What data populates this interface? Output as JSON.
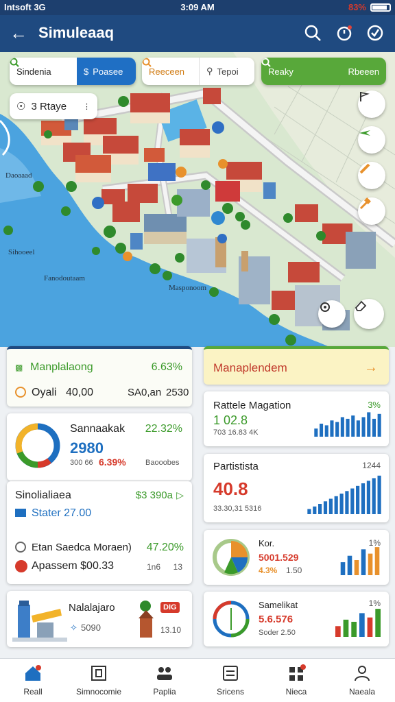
{
  "status": {
    "left": "Intsoft  3G",
    "time": "3:09 AM",
    "battery": "83%"
  },
  "appbar": {
    "title": "Simuleaaq",
    "icons": [
      "back-arrow-icon",
      "search-icon",
      "notification-icon",
      "clock-check-icon"
    ]
  },
  "map": {
    "chips": {
      "a1": "Sindenia",
      "a2": "Poasee",
      "b1": "Reeceen",
      "b2": "Tepoi",
      "c1": "Reaky",
      "c2": "Rbeeen"
    },
    "layer_chip": "3  Rtaye",
    "labels": [
      "Daoaaad",
      "Sihooeel",
      "Fanodoutaam",
      "Masponoom"
    ],
    "side_buttons": [
      "flag-icon",
      "plane-icon",
      "pencil-icon",
      "hammer-icon"
    ],
    "bottom_buttons": [
      "recenter-icon",
      "eraser-icon"
    ]
  },
  "colors": {
    "primary": "#1f4a80",
    "green": "#3b9a2a",
    "red": "#d63a2b",
    "blue": "#1e6fc0",
    "orange": "#e8912c"
  },
  "cards": {
    "top_left": {
      "title": "Manplalaong",
      "pct": "6.63%",
      "sub_label": "Oyali",
      "v1": "40,00",
      "v2": "SA0,an",
      "v3": "2530"
    },
    "top_right": {
      "title": "Manaplendem",
      "arrow": "→"
    },
    "mid_left": {
      "title": "Sannaakak",
      "pct": "22.32%",
      "value": "2980",
      "sub1": "300 66",
      "sub2": "6.39%",
      "sub3": "Baooobes"
    },
    "stats_left": {
      "row1_label": "Sinolialiaea",
      "row1_value": "$3 390a",
      "row2_label": "Stater 27.00",
      "row3_label": "Etan Saedca Moraen)",
      "row3_value": "47.20%",
      "row4_label": "Apassem $00.33",
      "row4_value": "1n6",
      "row4_extra": "13"
    },
    "bottom_left": {
      "title": "Nalalajaro",
      "badge": "DIG",
      "sub": "5090",
      "extra": "13.10"
    },
    "r1": {
      "title": "Rattele Magation",
      "pct": "3%",
      "value": "1 02.8",
      "sub": "703 16.83 4K"
    },
    "r2": {
      "title": "Partistista",
      "pct": "1244",
      "value": "40.8",
      "sub": "33.30,31 5316"
    },
    "r3": {
      "title": "Kor.",
      "pct": "1%",
      "value": "5001.529",
      "sub": "4.3%",
      "sub2": "1.50"
    },
    "r4": {
      "title": "Samelikat",
      "pct": "1%",
      "value": "5.6.576",
      "sub": "Soder 2.50"
    }
  },
  "chart_data": [
    {
      "type": "bar",
      "name_ref": "Rattele Magation",
      "values": [
        5,
        8,
        7,
        10,
        9,
        12,
        11,
        13,
        10,
        12,
        15,
        11,
        14
      ],
      "ylim": [
        0,
        16
      ],
      "colors": [
        "#1e6fc0"
      ]
    },
    {
      "type": "bar",
      "name_ref": "Partistista",
      "values": [
        2,
        3,
        4,
        5,
        6,
        7,
        8,
        9,
        10,
        11,
        12,
        13,
        14,
        15
      ],
      "ylim": [
        0,
        16
      ],
      "colors": [
        "#1e6fc0"
      ]
    },
    {
      "type": "bar",
      "name_ref": "Kor.",
      "values": [
        6,
        9,
        7,
        12,
        10,
        13
      ],
      "ylim": [
        0,
        14
      ],
      "colors": [
        "#1e6fc0",
        "#1e6fc0",
        "#e8912c",
        "#1e6fc0",
        "#e8912c",
        "#e8912c"
      ]
    },
    {
      "type": "bar",
      "name_ref": "Samelikat",
      "values": [
        5,
        8,
        7,
        11,
        9,
        13
      ],
      "ylim": [
        0,
        14
      ],
      "colors": [
        "#d63a2b",
        "#3b9a2a",
        "#3b9a2a",
        "#1e6fc0",
        "#d63a2b",
        "#3b9a2a"
      ]
    }
  ],
  "nav": [
    {
      "label": "Reall",
      "icon": "home-icon"
    },
    {
      "label": "Simnocomie",
      "icon": "box-icon"
    },
    {
      "label": "Paplia",
      "icon": "people-icon"
    },
    {
      "label": "Sricens",
      "icon": "list-icon"
    },
    {
      "label": "Nieca",
      "icon": "grid-icon"
    },
    {
      "label": "Naeala",
      "icon": "profile-icon"
    }
  ]
}
